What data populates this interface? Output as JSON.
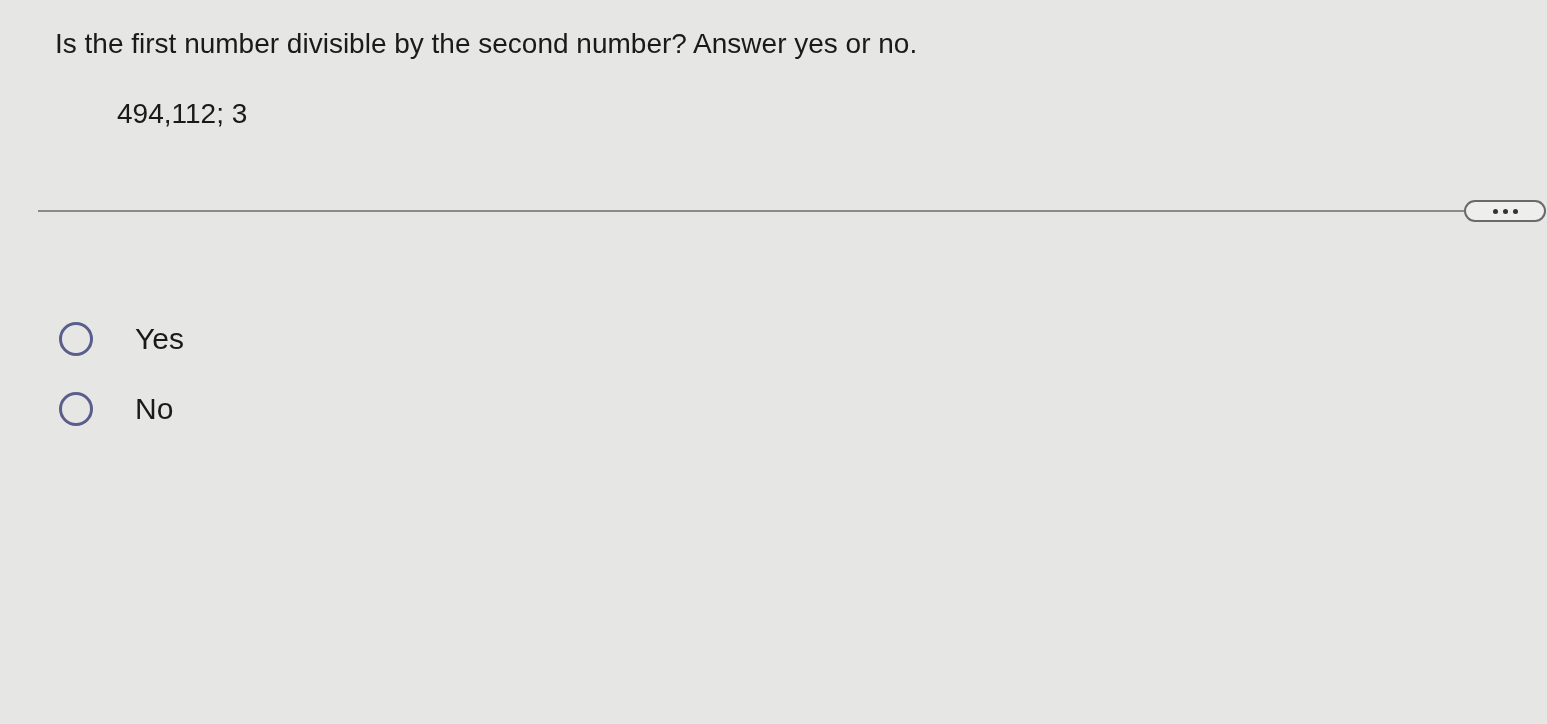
{
  "question": {
    "prompt": "Is the first number divisible by the second number? Answer yes or no.",
    "numbers": "494,112; 3"
  },
  "options": [
    {
      "label": "Yes",
      "selected": false
    },
    {
      "label": "No",
      "selected": false
    }
  ]
}
